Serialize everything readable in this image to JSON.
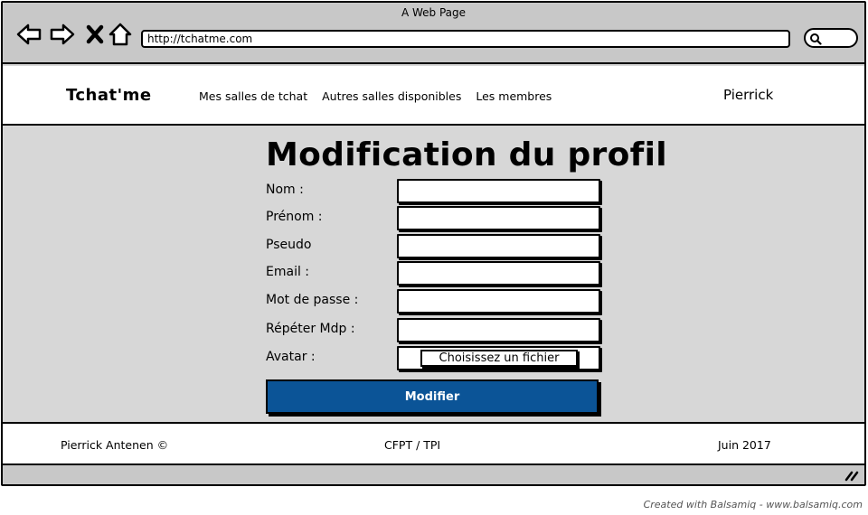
{
  "window": {
    "title": "A Web Page"
  },
  "browser": {
    "url": "http://tchatme.com",
    "icons": [
      "back-arrow-icon",
      "forward-arrow-icon",
      "close-x-icon",
      "home-icon",
      "search-icon"
    ]
  },
  "header": {
    "brand": "Tchat'me",
    "nav": [
      "Mes salles de tchat",
      "Autres salles disponibles",
      "Les membres"
    ],
    "user": "Pierrick"
  },
  "form": {
    "title": "Modification du profil",
    "fields": [
      {
        "label": "Nom :",
        "value": ""
      },
      {
        "label": "Prénom :",
        "value": ""
      },
      {
        "label": "Pseudo",
        "value": ""
      },
      {
        "label": "Email :",
        "value": ""
      },
      {
        "label": "Mot de passe :",
        "value": ""
      },
      {
        "label": "Répéter Mdp :",
        "value": ""
      }
    ],
    "avatar": {
      "label": "Avatar :",
      "button": "Choisissez un fichier"
    },
    "submit": "Modifier"
  },
  "footer": {
    "left": "Pierrick Antenen ©",
    "center": "CFPT / TPI",
    "right": "Juin 2017"
  },
  "credit": "Created with Balsamiq - www.balsamiq.com",
  "colors": {
    "accent": "#0b5497",
    "chrome": "#c8c8c8",
    "background": "#d7d7d7"
  }
}
